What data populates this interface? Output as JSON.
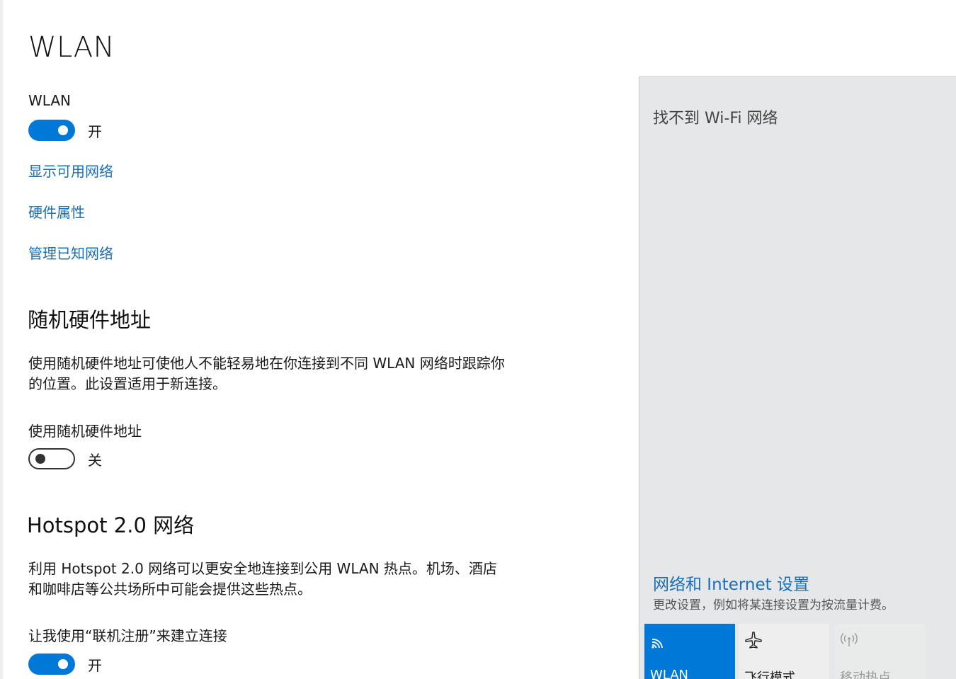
{
  "page": {
    "title": "WLAN"
  },
  "wlan": {
    "label": "WLAN",
    "toggle_state": "开",
    "toggle_on": true,
    "links": {
      "show_networks": "显示可用网络",
      "hardware_properties": "硬件属性",
      "manage_known": "管理已知网络"
    }
  },
  "random_mac": {
    "heading": "随机硬件地址",
    "description": "使用随机硬件地址可使他人不能轻易地在你连接到不同 WLAN 网络时跟踪你的位置。此设置适用于新连接。",
    "toggle_label": "使用随机硬件地址",
    "toggle_state": "关",
    "toggle_on": false
  },
  "hotspot20": {
    "heading": "Hotspot 2.0 网络",
    "description": "利用 Hotspot 2.0 网络可以更安全地连接到公用 WLAN 热点。机场、酒店和咖啡店等公共场所中可能会提供这些热点。",
    "toggle_label": "让我使用“联机注册”来建立连接",
    "toggle_state": "开",
    "toggle_on": true
  },
  "flyout": {
    "message": "找不到 Wi-Fi 网络",
    "settings_link": "网络和 Internet 设置",
    "settings_desc": "更改设置，例如将某连接设置为按流量计费。",
    "tiles": [
      {
        "label": "WLAN",
        "icon": "wifi-icon",
        "active": true
      },
      {
        "label": "飞行模式",
        "icon": "airplane-icon",
        "active": false
      },
      {
        "label": "移动热点",
        "icon": "hotspot-icon",
        "active": false,
        "disabled": true
      }
    ]
  },
  "colors": {
    "accent": "#0078d7",
    "link": "#1a6fb5",
    "flyout_bg": "#e6e7e8"
  }
}
